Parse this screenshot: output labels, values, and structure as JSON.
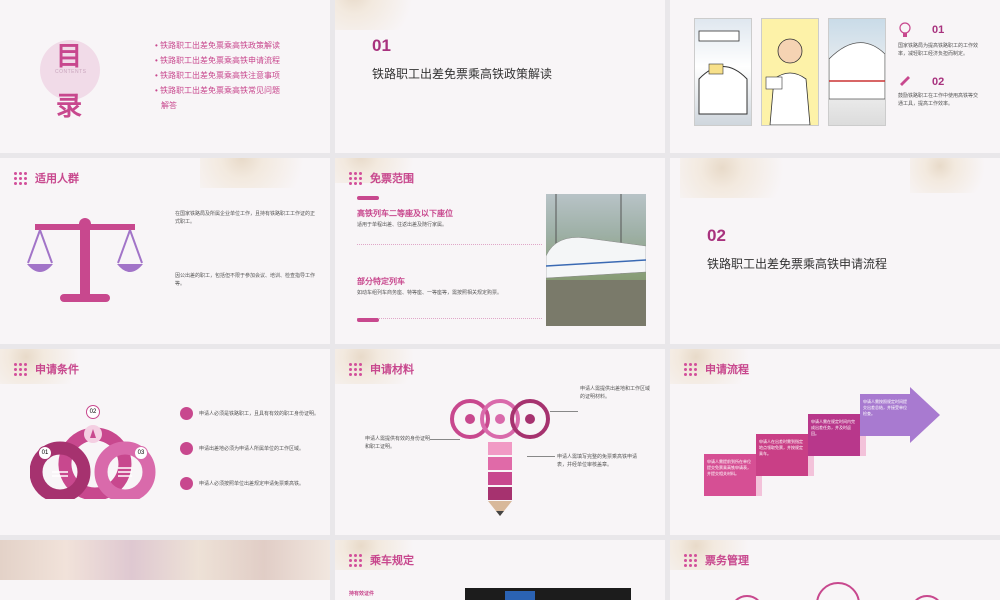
{
  "toc": {
    "title_chars": [
      "目",
      "录"
    ],
    "subtitle": "CONTENTS",
    "items": [
      "铁路职工出差免票乘高铁政策解读",
      "铁路职工出差免票乘高铁申请流程",
      "铁路职工出差免票乘高铁注意事项",
      "铁路职工出差免票乘高铁常见问题",
      "解答"
    ]
  },
  "section1": {
    "number": "01",
    "title": "铁路职工出差免票乘高铁政策解读"
  },
  "policy": {
    "points": [
      {
        "num": "01",
        "text": "国家铁路局为提高铁路职工的工作效率，减轻职工经济负担而制定。"
      },
      {
        "num": "02",
        "text": "鼓励铁路职工在工作中使用高铁等交通工具，提高工作效率。"
      }
    ]
  },
  "applicable": {
    "title": "适用人群",
    "texts": [
      "在国家铁路局及所属企业单位工作，且持有铁路职工工作证的正式职工。",
      "因公出差的职工，包括但不限于参加会议、培训、检查指导工作等。"
    ]
  },
  "scope": {
    "title": "免票范围",
    "items": [
      {
        "heading": "高铁列车二等座及以下座位",
        "text": "适用于单程出差、往返出差及随行家属。"
      },
      {
        "heading": "部分特定列车",
        "text": "如动车组列车商务座、特等座、一等座等，需按照相关规定购票。"
      }
    ]
  },
  "section2": {
    "number": "02",
    "title": "铁路职工出差免票乘高铁申请流程"
  },
  "conditions": {
    "title": "申请条件",
    "nums": [
      "01",
      "02",
      "03"
    ],
    "items": [
      "申请人必须是铁路职工，且具有有效的职工身份证明。",
      "申请出差地必须为申请人所属单位的工作区域。",
      "申请人必须按照单位出差规定申请免票乘高铁。"
    ]
  },
  "materials": {
    "title": "申请材料",
    "items": [
      "申请人需提供出差地和工作区域的证明材料。",
      "申请人需提供有效的身份证明和职工证明。",
      "申请人需填写完整的免票乘高铁申请表，并经单位审核盖章。"
    ]
  },
  "process": {
    "title": "申请流程",
    "steps": [
      "申请人需提前到所在单位提交免票乘高铁申请表，并提交相关材料。",
      "申请人在出差时需到指定地点领取免票，并按规定乘车。",
      "申请人需在规定时间内完成出差任务，并及时返回。",
      "申请人需按照规定时间提交出差总结，并接受单位检查。"
    ]
  },
  "rules": {
    "title": "乘车规定",
    "sub": "持有效证件"
  },
  "ticketing": {
    "title": "票务管理"
  },
  "colors": {
    "accent": "#c8488e",
    "accent2": "#a274c8",
    "bg": "#f8f5f7"
  }
}
